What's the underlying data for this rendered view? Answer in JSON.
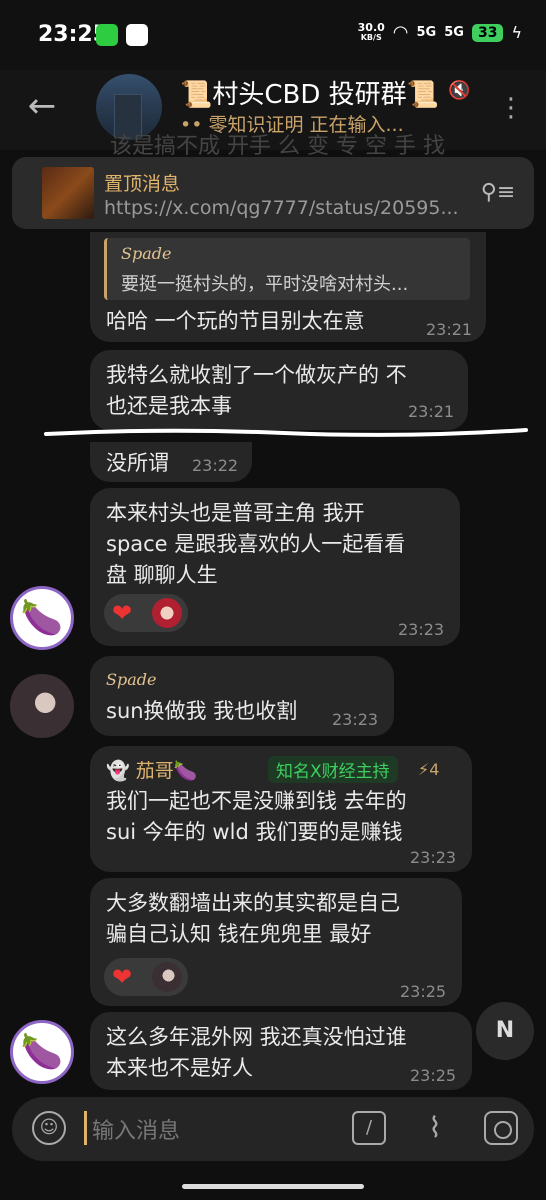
{
  "status_bar": {
    "time": "23:25",
    "net_speed": "30.0",
    "net_unit": "KB/S",
    "signal1": "5G",
    "signal2": "5G",
    "battery": "33"
  },
  "header": {
    "title": "📜村头CBD 投研群📜",
    "status": "•• 零知识证明 正在输入..."
  },
  "ghost_text": "该是搞不成 开手 么 变 专 空 手 找",
  "pinned": {
    "label": "置顶消息",
    "link": "https://x.com/qg7777/status/20595..."
  },
  "messages": [
    {
      "reply_name": "Spade",
      "reply_text": "要挺一挺村头的，平时没啥对村头...",
      "text": "哈哈 一个玩的节目别太在意",
      "time": "23:21"
    },
    {
      "text1": "我特么就收割了一个做灰产的 不",
      "text2": "也还是我本事",
      "time": "23:21"
    },
    {
      "text": "没所谓",
      "time": "23:22"
    },
    {
      "text1": "本来村头也是普哥主角  我开",
      "text2": "space 是跟我喜欢的人一起看看",
      "text3": "盘 聊聊人生",
      "reaction": "❤",
      "time": "23:23"
    },
    {
      "reply_name": "Spade",
      "text": "sun换做我 我也收割",
      "time": "23:23"
    },
    {
      "sender": "👻 茄哥🍆",
      "tag": "知名X财经主持",
      "rank": "⚡4",
      "text1": "我们一起也不是没赚到钱 去年的",
      "text2": "sui 今年的 wld 我们要的是赚钱",
      "time": "23:23"
    },
    {
      "text1": "大多数翻墙出来的其实都是自己",
      "text2": "骗自己认知 钱在兜兜里 最好",
      "reaction": "❤",
      "time": "23:25"
    },
    {
      "text1": "这么多年混外网 我还真没怕过谁",
      "text2": "本来也不是好人",
      "time": "23:25"
    }
  ],
  "input": {
    "placeholder": "输入消息"
  },
  "icons": {
    "back": "arrow-left-icon",
    "menu": "more-vertical-icon",
    "mute": "mute-icon",
    "pin": "pin-list-icon",
    "emoji": "smile-icon",
    "command": "slash-icon",
    "attach": "paperclip-icon",
    "camera": "camera-icon"
  },
  "colors": {
    "accent": "#e0b46d",
    "bubble": "#262626",
    "tag_green": "#3ecf5f"
  }
}
